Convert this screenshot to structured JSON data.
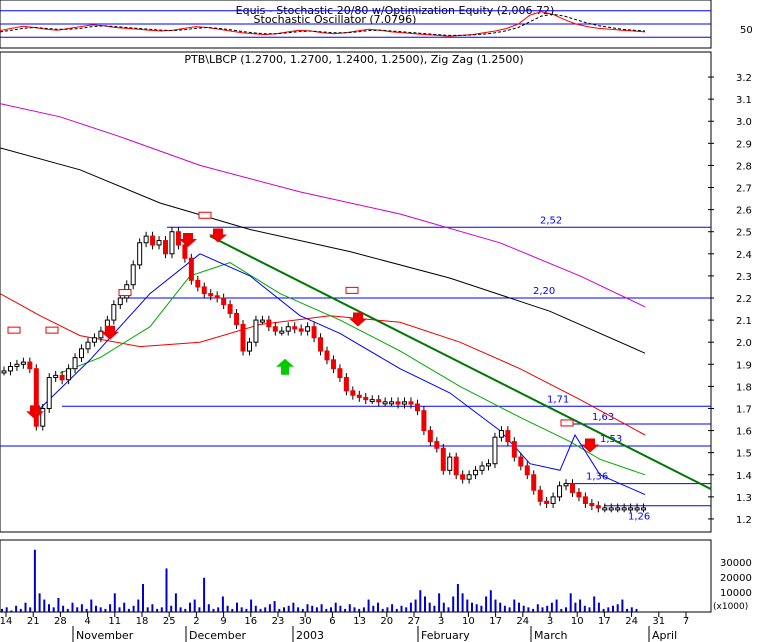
{
  "chart_data": [
    {
      "type": "line",
      "panel": "oscillator",
      "title": "Equis - Stochastic 20/80 w/Optimization Equity (2,006.72)",
      "subtitle": "Stochastic Oscillator (7.0796)",
      "y_ticks": [
        "50"
      ],
      "levels": [
        80,
        50,
        20
      ],
      "ylim": [
        0,
        100
      ],
      "series": [
        {
          "name": "%K",
          "color": "#ff0000",
          "values": [
            35,
            40,
            45,
            42,
            38,
            36,
            40,
            44,
            48,
            46,
            42,
            40,
            38,
            36,
            34,
            36,
            40,
            44,
            42,
            38,
            34,
            30,
            28,
            26,
            28,
            32,
            36,
            34,
            30,
            28,
            30,
            34,
            38,
            36,
            32,
            30,
            28,
            26,
            24,
            22,
            24,
            26,
            30,
            34,
            40,
            50,
            70,
            78,
            72,
            60,
            50,
            44,
            40,
            38,
            36,
            34,
            32
          ]
        },
        {
          "name": "%D",
          "color": "#000000",
          "values": [
            32,
            36,
            40,
            42,
            40,
            38,
            38,
            40,
            44,
            46,
            44,
            42,
            40,
            38,
            36,
            35,
            37,
            40,
            42,
            40,
            37,
            33,
            30,
            28,
            28,
            30,
            33,
            34,
            32,
            30,
            30,
            32,
            35,
            36,
            34,
            32,
            30,
            28,
            26,
            24,
            24,
            25,
            27,
            30,
            35,
            42,
            55,
            68,
            72,
            68,
            60,
            52,
            46,
            42,
            38,
            36,
            34
          ]
        }
      ]
    },
    {
      "type": "line",
      "panel": "price",
      "title": "PTB\\LBCP (1.2700, 1.2700, 1.2400, 1.2500), Zig Zag (1.2500)",
      "y_ticks": [
        "3.2",
        "3.1",
        "3.0",
        "2.9",
        "2.8",
        "2.7",
        "2.6",
        "2.5",
        "2.4",
        "2.3",
        "2.2",
        "2.1",
        "2.0",
        "1.9",
        "1.8",
        "1.7",
        "1.6",
        "1.5",
        "1.4",
        "1.3",
        "1.2"
      ],
      "ylim": [
        1.15,
        3.25
      ],
      "x_ticks": [
        "14",
        "21",
        "28",
        "4",
        "11",
        "18",
        "25",
        "2",
        "9",
        "16",
        "23",
        "30",
        "6",
        "13",
        "20",
        "27",
        "3",
        "10",
        "17",
        "24",
        "3",
        "10",
        "17",
        "24",
        "31",
        "7"
      ],
      "months": [
        "November",
        "December",
        "2003",
        "February",
        "March",
        "April"
      ],
      "horizontal_levels": [
        {
          "label": "2,52",
          "value": 2.52
        },
        {
          "label": "2,20",
          "value": 2.2
        },
        {
          "label": "1,71",
          "value": 1.71
        },
        {
          "label": "1,63",
          "value": 1.63
        },
        {
          "label": "1,53",
          "value": 1.53
        },
        {
          "label": "1,36",
          "value": 1.36
        },
        {
          "label": "1,26",
          "value": 1.26
        }
      ],
      "series": [
        {
          "name": "Close",
          "color": "#000000",
          "x": [
            0,
            2,
            4,
            6,
            8,
            10,
            12,
            14,
            16,
            18,
            20,
            22,
            24,
            26,
            28,
            30,
            32,
            34,
            36,
            38,
            40,
            42,
            44,
            46,
            48,
            50,
            52,
            54,
            56,
            58,
            60,
            62,
            64,
            66,
            68,
            70,
            72,
            74,
            76,
            78,
            80,
            82,
            84,
            86,
            88,
            90,
            92,
            94,
            96,
            98,
            100,
            102,
            104,
            106,
            108,
            110,
            112,
            114,
            116,
            118,
            120,
            122,
            124,
            126,
            128,
            130,
            132,
            134,
            136,
            138,
            140,
            142,
            144,
            146,
            148,
            150,
            152,
            154,
            156,
            158,
            160,
            162,
            164,
            166,
            168,
            170,
            172,
            174,
            176,
            178,
            180,
            182,
            184,
            186,
            188,
            190,
            192,
            194,
            196,
            198
          ],
          "values": [
            1.87,
            1.89,
            1.9,
            1.91,
            1.88,
            1.62,
            1.7,
            1.84,
            1.85,
            1.83,
            1.88,
            1.93,
            1.97,
            2.0,
            2.02,
            2.05,
            2.1,
            2.17,
            2.2,
            2.26,
            2.35,
            2.45,
            2.48,
            2.44,
            2.46,
            2.4,
            2.5,
            2.44,
            2.38,
            2.28,
            2.25,
            2.22,
            2.21,
            2.2,
            2.17,
            2.13,
            2.08,
            1.96,
            2.0,
            2.1,
            2.1,
            2.07,
            2.05,
            2.05,
            2.07,
            2.06,
            2.05,
            2.07,
            2.02,
            1.96,
            1.92,
            1.88,
            1.84,
            1.78,
            1.76,
            1.75,
            1.74,
            1.74,
            1.73,
            1.73,
            1.73,
            1.72,
            1.73,
            1.72,
            1.69,
            1.6,
            1.55,
            1.52,
            1.42,
            1.48,
            1.4,
            1.38,
            1.4,
            1.42,
            1.44,
            1.45,
            1.57,
            1.6,
            1.55,
            1.48,
            1.44,
            1.4,
            1.33,
            1.28,
            1.27,
            1.3,
            1.35,
            1.36,
            1.32,
            1.3,
            1.27,
            1.26,
            1.25,
            1.25,
            1.25,
            1.25,
            1.25,
            1.25,
            1.25,
            1.25
          ]
        }
      ]
    },
    {
      "type": "bar",
      "panel": "volume",
      "y_ticks": [
        "30000",
        "20000",
        "10000"
      ],
      "unit": "(x1000)",
      "values": [
        2,
        3,
        1,
        4,
        2,
        6,
        3,
        40,
        12,
        8,
        5,
        3,
        9,
        4,
        2,
        6,
        3,
        5,
        2,
        8,
        4,
        3,
        2,
        5,
        12,
        3,
        6,
        2,
        4,
        8,
        18,
        3,
        5,
        2,
        3,
        28,
        4,
        12,
        3,
        2,
        6,
        8,
        3,
        22,
        5,
        2,
        3,
        10,
        4,
        2,
        6,
        3,
        2,
        8,
        4,
        2,
        3,
        5,
        7,
        2,
        3,
        4,
        6,
        3,
        2,
        5,
        4,
        3,
        5,
        2,
        3,
        6,
        4,
        2,
        5,
        3,
        2,
        3,
        8,
        4,
        6,
        2,
        3,
        5,
        2,
        4,
        3,
        6,
        8,
        14,
        10,
        6,
        4,
        12,
        6,
        3,
        10,
        18,
        12,
        8,
        6,
        5,
        4,
        10,
        14,
        8,
        6,
        4,
        3,
        8,
        6,
        4,
        3,
        2,
        5,
        3,
        4,
        6,
        8,
        2,
        3,
        12,
        6,
        8,
        4,
        3,
        10,
        6,
        2,
        3,
        4,
        5,
        8,
        2,
        3,
        2
      ]
    }
  ]
}
